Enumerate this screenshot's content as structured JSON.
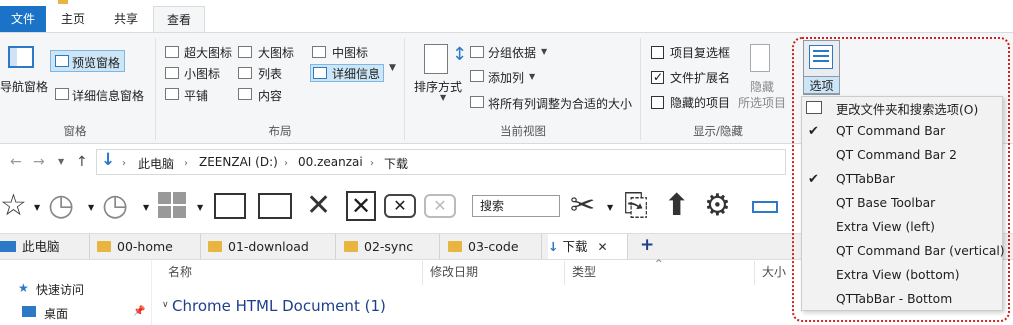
{
  "ribbon_tabs": {
    "file": "文件",
    "home": "主页",
    "share": "共享",
    "view": "查看"
  },
  "ribbon": {
    "nav_pane": "导航窗格",
    "preview_pane": "预览窗格",
    "details_pane": "详细信息窗格",
    "group_panes": "窗格",
    "layout": {
      "extra_large": "超大图标",
      "large": "大图标",
      "medium": "中图标",
      "small": "小图标",
      "list": "列表",
      "details": "详细信息",
      "tiles": "平铺",
      "content": "内容"
    },
    "group_layout": "布局",
    "sort_by": "排序方式",
    "group_by": "分组依据",
    "add_column": "添加列",
    "fit_columns": "将所有列调整为合适的大小",
    "group_current_view": "当前视图",
    "item_checkboxes": "项目复选框",
    "file_extensions": "文件扩展名",
    "hidden_items": "隐藏的项目",
    "hide": "隐藏",
    "hide_selected": "所选项目",
    "group_show_hide": "显示/隐藏",
    "options": "选项"
  },
  "address": {
    "this_pc": "此电脑",
    "drive": "ZEENZAI (D:)",
    "folder1": "00.zeanzai",
    "folder2": "下载"
  },
  "toolbar": {
    "search_label": "搜索"
  },
  "tabs": [
    {
      "label": "此电脑"
    },
    {
      "label": "00-home"
    },
    {
      "label": "01-download"
    },
    {
      "label": "02-sync"
    },
    {
      "label": "03-code"
    },
    {
      "label": "下载"
    }
  ],
  "file_list": {
    "col_name": "名称",
    "col_modified": "修改日期",
    "col_type": "类型",
    "col_size": "大小",
    "group_header": "Chrome HTML Document (1)"
  },
  "nav": {
    "quick_access": "快速访问",
    "desktop": "桌面"
  },
  "menu": {
    "items": [
      {
        "label": "更改文件夹和搜索选项(O)",
        "checked": false
      },
      {
        "label": "QT Command Bar",
        "checked": true
      },
      {
        "label": "QT Command Bar 2",
        "checked": false
      },
      {
        "label": "QTTabBar",
        "checked": true
      },
      {
        "label": "QT Base Toolbar",
        "checked": false
      },
      {
        "label": "Extra View (left)",
        "checked": false
      },
      {
        "label": "QT Command Bar (vertical)",
        "checked": false
      },
      {
        "label": "Extra View (bottom)",
        "checked": false
      },
      {
        "label": "QTTabBar - Bottom",
        "checked": false
      }
    ],
    "check_glyph": "✔"
  },
  "colors": {
    "accent": "#1a73c7",
    "highlight": "#cde6f7",
    "annotation": "#d42020"
  }
}
